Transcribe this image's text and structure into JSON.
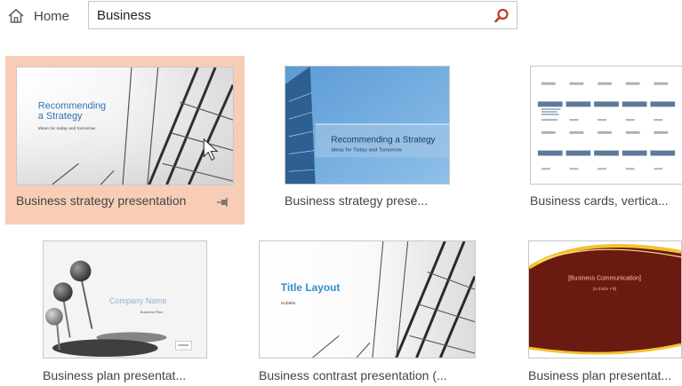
{
  "header": {
    "home_label": "Home",
    "search": {
      "value": "Business",
      "placeholder": ""
    }
  },
  "colors": {
    "selected_tile": "#f8cdb6",
    "search_icon": "#c0392b",
    "accent_blue": "#2e74b5",
    "maroon": "#6a1a10",
    "gold": "#f2c230"
  },
  "templates": [
    {
      "caption": "Business strategy presentation",
      "selected": true,
      "pin_icon": "pin-icon",
      "thumb": {
        "title_line1": "Recommending",
        "title_line2": "a Strategy",
        "subtitle": "Ideas for today and tomorrow"
      }
    },
    {
      "caption": "Business strategy prese...",
      "thumb": {
        "title": "Recommending a Strategy",
        "subtitle": "Ideas for Today and Tomorrow"
      }
    },
    {
      "caption": "Business cards, vertica...",
      "thumb": {}
    },
    {
      "caption": "Business plan presentat...",
      "thumb": {
        "title": "Company Name",
        "subtitle": "Business Plan"
      }
    },
    {
      "caption": "Business contrast presentation (...",
      "thumb": {
        "title": "Title Layout",
        "subtitle": "Subtitle"
      }
    },
    {
      "caption": "Business plan presentat...",
      "thumb": {
        "title": "[Business Communication]",
        "subtitle": "[Subtitle Fill]"
      }
    }
  ]
}
